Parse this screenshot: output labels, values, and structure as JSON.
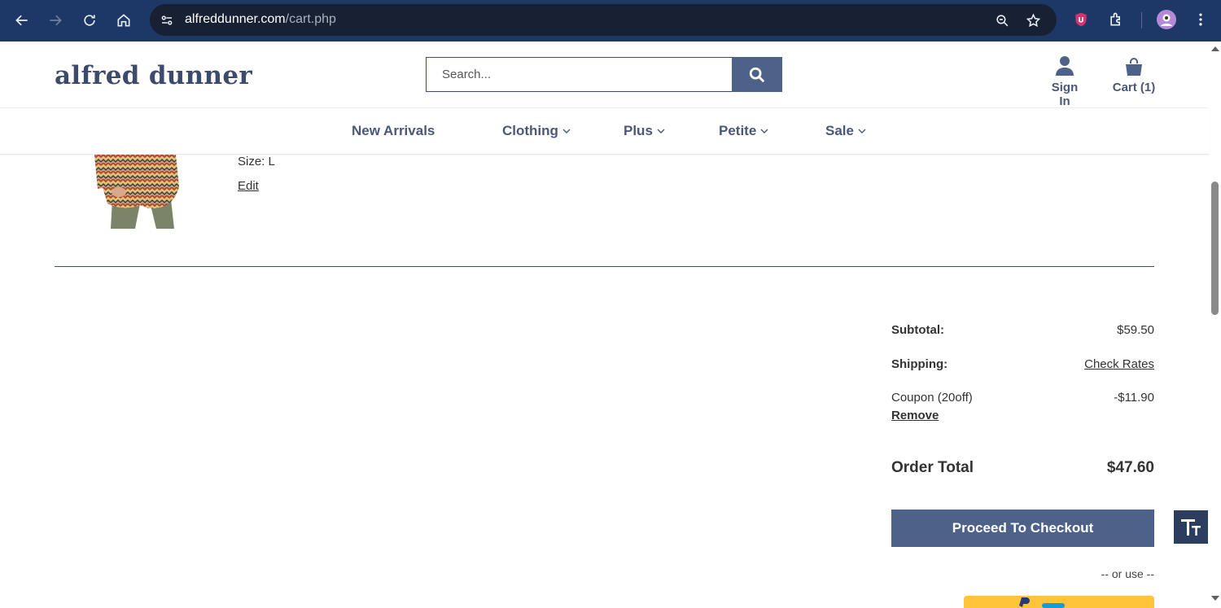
{
  "browser": {
    "url_domain": "alfreddunner.com",
    "url_path": "/cart.php"
  },
  "header": {
    "logo": "alfred dunner",
    "search_placeholder": "Search...",
    "sign_in": "Sign In",
    "cart": "Cart (1)"
  },
  "nav": {
    "items": [
      {
        "label": "New Arrivals"
      },
      {
        "label": "Clothing"
      },
      {
        "label": "Plus"
      },
      {
        "label": "Petite"
      },
      {
        "label": "Sale"
      }
    ]
  },
  "cart_item": {
    "size": "Size: L",
    "edit": "Edit"
  },
  "summary": {
    "subtotal_label": "Subtotal:",
    "subtotal_value": "$59.50",
    "shipping_label": "Shipping:",
    "shipping_value": "Check Rates",
    "coupon_label": "Coupon (20off)",
    "coupon_remove": "Remove",
    "coupon_value": "-$11.90",
    "total_label": "Order Total",
    "total_value": "$47.60",
    "checkout": "Proceed To Checkout",
    "or_use": "-- or use --"
  },
  "colors": {
    "brand": "#4e6289",
    "chrome": "#1d3766"
  }
}
